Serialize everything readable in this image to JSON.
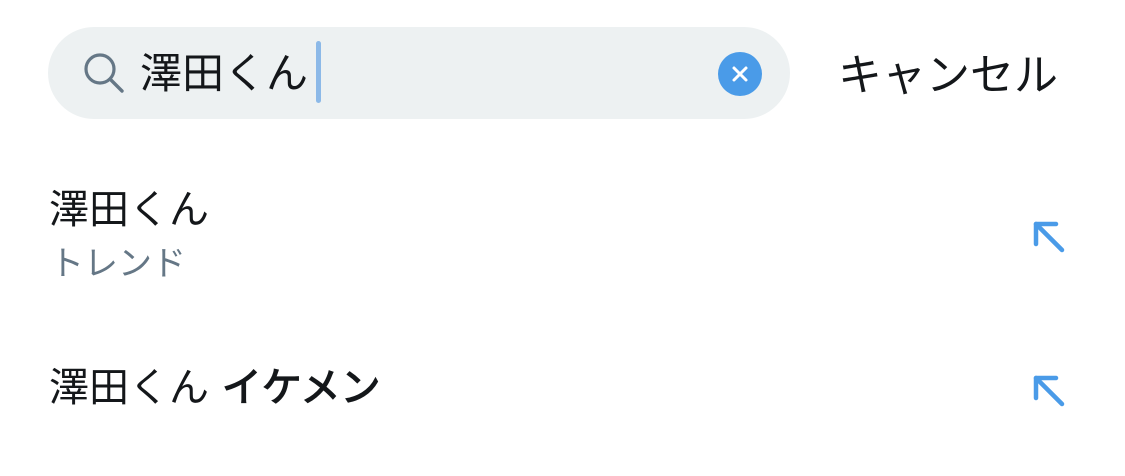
{
  "search": {
    "query": "澤田くん",
    "clear_icon": "clear-x-icon",
    "search_icon": "magnifier-icon",
    "cancel_label": "キャンセル"
  },
  "suggestions": [
    {
      "title": "澤田くん",
      "subtitle": "トレンド",
      "icon": "fill-query-arrow-icon"
    },
    {
      "title_prefix": "澤田くん ",
      "title_bold": "イケメン",
      "icon": "fill-query-arrow-icon"
    }
  ],
  "colors": {
    "accent": "#4a9be8",
    "search_bg": "#edf1f2",
    "secondary_text": "#657786",
    "caret": "#8cb9e8"
  }
}
